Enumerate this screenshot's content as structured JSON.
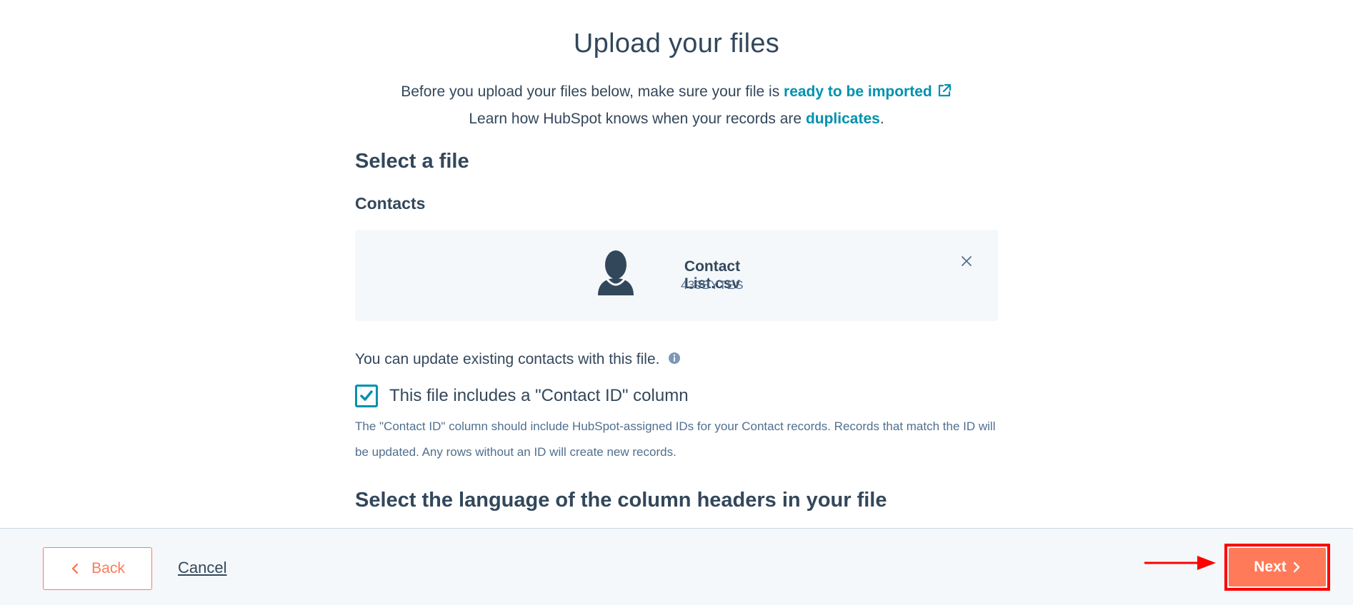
{
  "header": {
    "title": "Upload your files"
  },
  "intro": {
    "line1_prefix": "Before you upload your files below, make sure your file is ",
    "line1_link": "ready to be imported",
    "line2_prefix": "Learn how HubSpot knows when your records are ",
    "line2_link": "duplicates",
    "line2_suffix": "."
  },
  "select_file": {
    "title": "Select a file",
    "object_label": "Contacts",
    "file": {
      "name": "Contact List.csv",
      "size": "439BYTES"
    }
  },
  "update": {
    "note": "You can update existing contacts with this file.",
    "checkbox_label": "This file includes a \"Contact ID\" column",
    "checked": true,
    "help_text": "The \"Contact ID\" column should include HubSpot-assigned IDs for your Contact records. Records that match the ID will be updated. Any rows without an ID will create new records."
  },
  "language": {
    "title": "Select the language of the column headers in your file"
  },
  "footer": {
    "back_label": "Back",
    "cancel_label": "Cancel",
    "next_label": "Next"
  },
  "colors": {
    "accent": "#ff7a59",
    "link": "#0091ae",
    "text": "#33475b",
    "annotation": "#ff0000"
  },
  "icons": {
    "external_link": "external-link-icon",
    "avatar": "contact-avatar-icon",
    "remove": "close-icon",
    "info": "info-icon",
    "check": "checkmark-icon",
    "back": "chevron-left-icon",
    "next": "chevron-right-icon"
  }
}
